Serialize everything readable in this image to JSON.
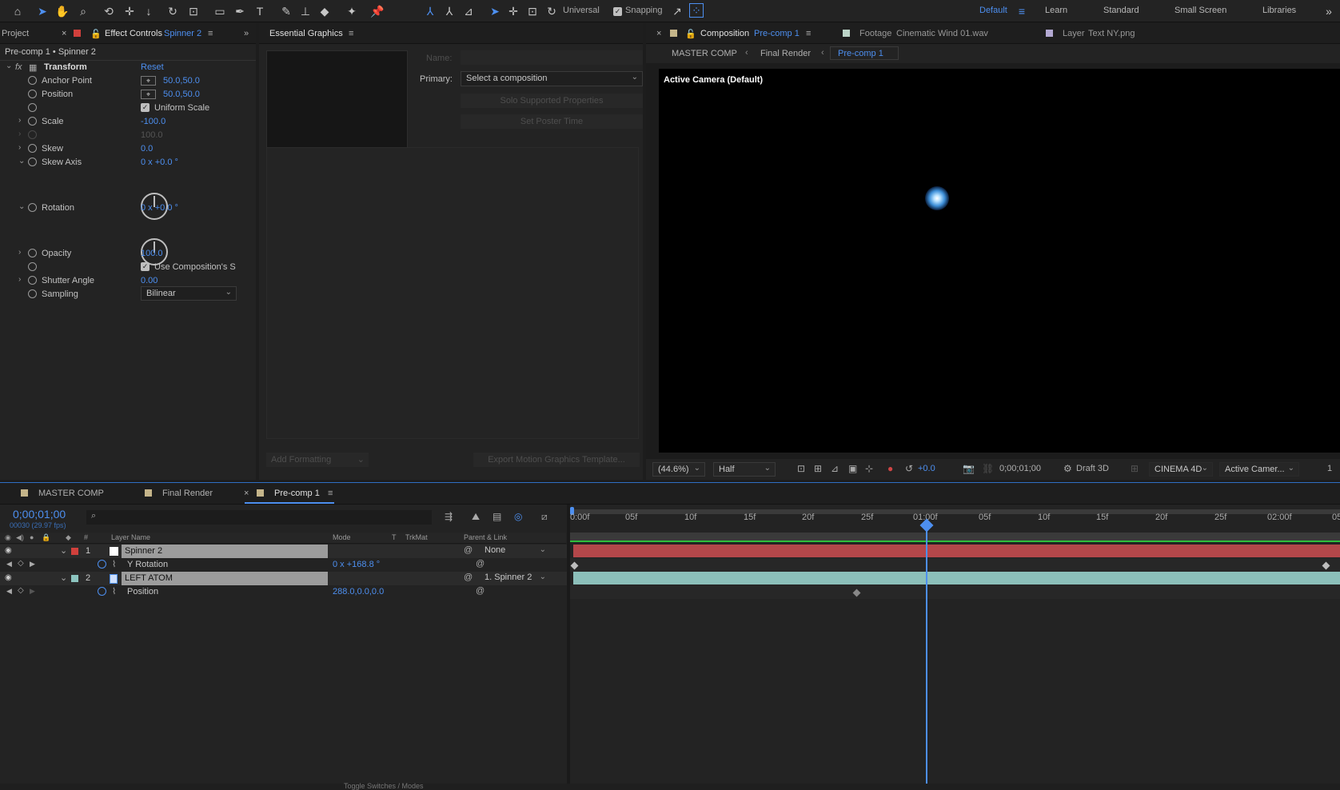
{
  "toolbar": {
    "mode_label": "Universal",
    "snapping_label": "Snapping",
    "workspaces": [
      "Default",
      "Learn",
      "Standard",
      "Small Screen",
      "Libraries"
    ],
    "active_workspace": "Default"
  },
  "left_panel": {
    "tab_project": "Project",
    "tab_effect_controls": "Effect Controls",
    "tab_effect_layer": "Spinner 2",
    "breadcrumb": "Pre-comp 1 • Spinner 2",
    "effect_name": "Transform",
    "reset_label": "Reset",
    "props": {
      "anchor_label": "Anchor Point",
      "anchor_value": "50.0,50.0",
      "position_label": "Position",
      "position_value": "50.0,50.0",
      "uniform_label": "Uniform Scale",
      "scale_label": "Scale",
      "scale_value": "-100.0",
      "scale_width_value": "100.0",
      "skew_label": "Skew",
      "skew_value": "0.0",
      "skew_axis_label": "Skew Axis",
      "skew_axis_value": "0 x +0.0 °",
      "rotation_label": "Rotation",
      "rotation_value": "0 x +0.0 °",
      "opacity_label": "Opacity",
      "opacity_value": "100.0",
      "use_comp_label": "Use Composition's S",
      "shutter_label": "Shutter Angle",
      "shutter_value": "0.00",
      "sampling_label": "Sampling",
      "sampling_value": "Bilinear"
    }
  },
  "essential_graphics": {
    "tab_label": "Essential Graphics",
    "name_label": "Name:",
    "primary_label": "Primary:",
    "primary_value": "Select a composition",
    "solo_label": "Solo Supported Properties",
    "poster_label": "Set Poster Time",
    "add_formatting_label": "Add Formatting",
    "export_label": "Export Motion Graphics Template..."
  },
  "composition": {
    "tab_label": "Composition",
    "tab_comp_name": "Pre-comp 1",
    "footage_tab": "Footage",
    "footage_name": "Cinematic Wind 01.wav",
    "layer_tab": "Layer",
    "layer_name": "Text NY.png",
    "crumbs": [
      "MASTER COMP",
      "Final Render",
      "Pre-comp 1"
    ],
    "camera_label": "Active Camera (Default)",
    "zoom": "(44.6%)",
    "resolution": "Half",
    "exposure": "+0.0",
    "timecode": "0;00;01;00",
    "draft_label": "Draft 3D",
    "renderer": "CINEMA 4D",
    "view": "Active Camer...",
    "views_count": "1"
  },
  "timeline": {
    "tabs": [
      "MASTER COMP",
      "Final Render",
      "Pre-comp 1"
    ],
    "current_time": "0;00;01;00",
    "frame_info": "00030 (29.97 fps)",
    "col_layer_name": "Layer Name",
    "col_mode": "Mode",
    "col_t": "T",
    "col_trkmat": "TrkMat",
    "col_parent": "Parent & Link",
    "ruler_labels": [
      "0:00f",
      "05f",
      "10f",
      "15f",
      "20f",
      "25f",
      "01:00f",
      "05f",
      "10f",
      "15f",
      "20f",
      "25f",
      "02:00f",
      "05"
    ],
    "layers": [
      {
        "num": "1",
        "name": "Spinner 2",
        "parent": "None",
        "prop_name": "Y Rotation",
        "prop_value": "0 x +168.8 °",
        "color": "#d0403c"
      },
      {
        "num": "2",
        "name": "LEFT ATOM",
        "parent": "1. Spinner 2",
        "prop_name": "Position",
        "prop_value": "288.0,0.0,0.0",
        "color": "#8cc4bf"
      }
    ],
    "toggle_label": "Toggle Switches / Modes"
  }
}
